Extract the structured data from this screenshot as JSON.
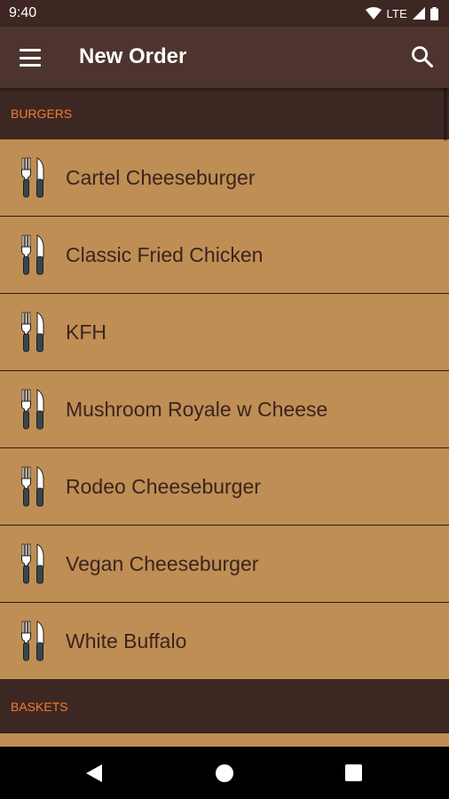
{
  "status_bar": {
    "time": "9:40",
    "network": "LTE",
    "icons": [
      "wifi-icon",
      "cell-signal-icon",
      "battery-icon"
    ]
  },
  "app_bar": {
    "title": "New Order",
    "menu_icon": "hamburger-menu-icon",
    "search_icon": "search-icon"
  },
  "sections": [
    {
      "title": "BURGERS",
      "items": [
        {
          "label": "Cartel Cheeseburger",
          "icon": "fork-knife-icon"
        },
        {
          "label": "Classic Fried Chicken",
          "icon": "fork-knife-icon"
        },
        {
          "label": "KFH",
          "icon": "fork-knife-icon"
        },
        {
          "label": "Mushroom Royale w Cheese",
          "icon": "fork-knife-icon"
        },
        {
          "label": "Rodeo Cheeseburger",
          "icon": "fork-knife-icon"
        },
        {
          "label": "Vegan Cheeseburger",
          "icon": "fork-knife-icon"
        },
        {
          "label": "White Buffalo",
          "icon": "fork-knife-icon"
        }
      ]
    },
    {
      "title": "BASKETS",
      "items": []
    }
  ],
  "colors": {
    "status_bar": "#3e2723",
    "app_bar": "#4e342e",
    "background": "#3d2723",
    "item_background": "#bf8e54",
    "section_header_text": "#f57c2b",
    "item_text": "#3a2420"
  },
  "nav_bar": {
    "buttons": [
      "back-icon",
      "home-icon",
      "recents-icon"
    ]
  }
}
